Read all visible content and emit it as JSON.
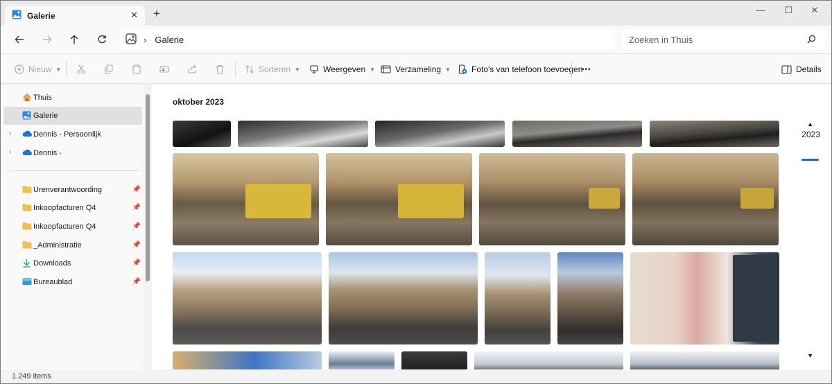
{
  "window": {
    "tab_title": "Galerie",
    "new_tab_glyph": "+",
    "close_tab_glyph": "✕",
    "controls": {
      "minimize": "—",
      "maximize": "☐",
      "close": "✕"
    }
  },
  "address": {
    "path": "Galerie",
    "search_placeholder": "Zoeken in Thuis"
  },
  "toolbar": {
    "new_label": "Nieuw",
    "sort_label": "Sorteren",
    "view_label": "Weergeven",
    "collection_label": "Verzameling",
    "add_phone_label": "Foto's van telefoon toevoegen",
    "more_label": "•••",
    "details_label": "Details"
  },
  "sidebar": {
    "items": [
      {
        "label": "Thuis",
        "icon": "home-icon"
      },
      {
        "label": "Galerie",
        "icon": "gallery-icon",
        "selected": true
      },
      {
        "label": "Dennis - Persoonlijk",
        "icon": "onedrive-icon"
      },
      {
        "label": "Dennis -",
        "icon": "onedrive-icon"
      }
    ],
    "quick_access": [
      {
        "label": "Urenverantwoording",
        "icon": "folder-icon"
      },
      {
        "label": "Inkoopfacturen Q4",
        "icon": "folder-icon"
      },
      {
        "label": "Inkoopfacturen Q4",
        "icon": "folder-icon"
      },
      {
        "label": "_Administratie",
        "icon": "folder-icon"
      },
      {
        "label": "Downloads",
        "icon": "download-icon"
      },
      {
        "label": "Bureaublad",
        "icon": "desktop-icon"
      }
    ]
  },
  "content": {
    "month_label": "oktober 2023",
    "timeline_year": "2023"
  },
  "status": {
    "item_count": "1.249 items"
  },
  "colors": {
    "accent": "#1a6fc4",
    "folder": "#f0c14b",
    "onedrive": "#1e74d6",
    "selected_bg": "#e0e0e0"
  }
}
